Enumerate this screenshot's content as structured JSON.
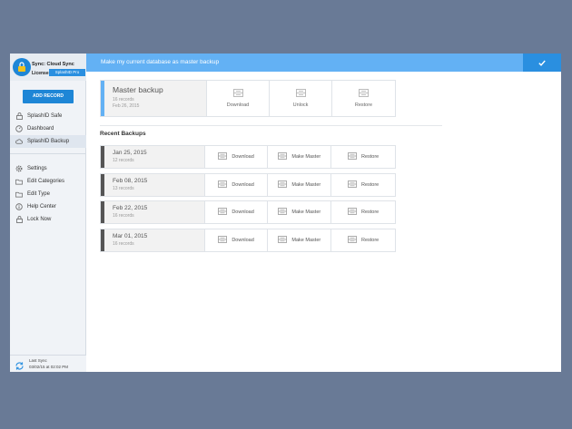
{
  "sidebar": {
    "header": {
      "sync_title": "Sync: Cloud Sync",
      "license_label": "License",
      "license_badge": "SplashID Pro"
    },
    "add_record_label": "ADD RECORD",
    "primary_items": [
      {
        "label": "SplashID Safe",
        "icon": "lock-icon",
        "active": false
      },
      {
        "label": "Dashboard",
        "icon": "dashboard-icon",
        "active": false
      },
      {
        "label": "SplashID Backup",
        "icon": "cloud-icon",
        "active": true
      }
    ],
    "secondary_items": [
      {
        "label": "Settings",
        "icon": "gear-icon"
      },
      {
        "label": "Edit Categories",
        "icon": "folder-icon"
      },
      {
        "label": "Edit Type",
        "icon": "folder-icon"
      },
      {
        "label": "Help Center",
        "icon": "info-icon"
      },
      {
        "label": "Lock Now",
        "icon": "lock-icon"
      }
    ],
    "footer": {
      "label": "Last Sync",
      "date": "03/02/15 at 02:02 PM"
    }
  },
  "banner": {
    "text": "Make my current database as master backup",
    "confirm_icon": "checkmark-icon"
  },
  "master": {
    "title": "Master backup",
    "records": "16 records",
    "date": "Feb 26, 2015",
    "actions": {
      "download": "Download",
      "unlock": "Unlock",
      "restore": "Restore"
    }
  },
  "recent": {
    "title": "Recent Backups",
    "action_labels": {
      "download": "Download",
      "make_master": "Make Master",
      "restore": "Restore"
    },
    "items": [
      {
        "date": "Jan 25, 2015",
        "records": "12 records"
      },
      {
        "date": "Feb 08, 2015",
        "records": "13 records"
      },
      {
        "date": "Feb 22, 2015",
        "records": "16 records"
      },
      {
        "date": "Mar 01, 2015",
        "records": "16 records"
      }
    ]
  },
  "colors": {
    "accent": "#2a8fe0",
    "banner": "#63b1f4",
    "background": "#697a96"
  }
}
